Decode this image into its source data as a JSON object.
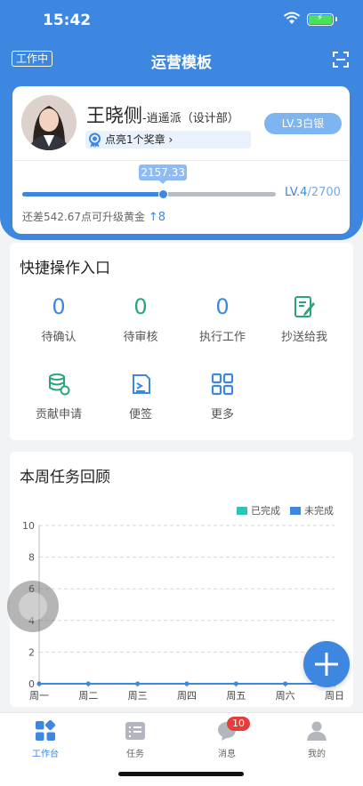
{
  "status_bar": {
    "time": "15:42"
  },
  "nav": {
    "work_status": "工作中",
    "title": "运营模板"
  },
  "profile": {
    "name": "王晓侧",
    "dept": "-逍遥派（设计部）",
    "award_text": "点亮1个奖章",
    "level_badge": "LV.3白银",
    "points": "2157.33",
    "progress_fraction": 0.555,
    "next_level": "LV.4",
    "next_level_points": "/2700",
    "upgrade_tip": "还差542.67点可升级黄金",
    "upgrade_rank": "8"
  },
  "quick": {
    "title": "快捷操作入口",
    "counters": [
      {
        "value": "0",
        "label": "待确认",
        "color": "#3d87e0"
      },
      {
        "value": "0",
        "label": "待审核",
        "color": "#2aa57a"
      },
      {
        "value": "0",
        "label": "执行工作",
        "color": "#3d87e0"
      }
    ],
    "items": [
      {
        "icon": "cc-document-icon",
        "label": "抄送给我"
      },
      {
        "icon": "database-icon",
        "label": "贡献申请"
      },
      {
        "icon": "note-edit-icon",
        "label": "便签"
      },
      {
        "icon": "grid-icon",
        "label": "更多"
      }
    ]
  },
  "weekly": {
    "title": "本周任务回顾"
  },
  "chart_data": {
    "type": "line",
    "categories": [
      "周一",
      "周二",
      "周三",
      "周四",
      "周五",
      "周六",
      "周日"
    ],
    "series": [
      {
        "name": "已完成",
        "color": "#2ec4b6",
        "values": [
          0,
          0,
          0,
          0,
          0,
          0,
          0
        ]
      },
      {
        "name": "未完成",
        "color": "#3d87e0",
        "values": [
          0,
          0,
          0,
          0,
          0,
          0,
          0
        ]
      }
    ],
    "yticks": [
      "0",
      "2",
      "4",
      "6",
      "8",
      "10"
    ],
    "ylim": [
      0,
      10
    ],
    "grid": true,
    "legend": "top-right"
  },
  "tabbar": {
    "tabs": [
      {
        "label": "工作台",
        "icon": "workbench-icon"
      },
      {
        "label": "任务",
        "icon": "task-list-icon"
      },
      {
        "label": "消息",
        "icon": "message-icon"
      },
      {
        "label": "我的",
        "icon": "user-icon"
      }
    ],
    "message_badge": "10"
  },
  "colors": {
    "primary": "#3d87e0",
    "green": "#2aa57a",
    "badge": "#e53c3c"
  }
}
